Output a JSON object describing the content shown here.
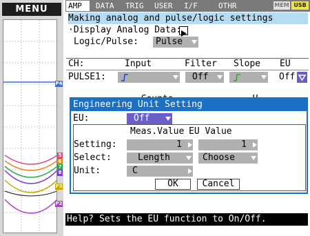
{
  "menu_label": "MENU",
  "tabs": [
    {
      "label": "AMP",
      "active": true
    },
    {
      "label": "DATA"
    },
    {
      "label": "TRIG"
    },
    {
      "label": "USER"
    },
    {
      "label": "I/F"
    },
    {
      "label": "OTHR"
    }
  ],
  "badges": [
    "MEM",
    "USB"
  ],
  "heading": "Making analog and pulse/logic settings",
  "display_analog_label": "·Display Analog Data:",
  "display_analog_icon": "play-triangle-icon",
  "logic_pulse": {
    "label": "Logic/Pulse:",
    "value": "Pulse"
  },
  "channel_table": {
    "headers": [
      "CH:",
      "Input",
      "Filter",
      "Slope",
      "EU"
    ],
    "row": {
      "ch": "PULSE1:",
      "input": "Counts",
      "filter": "Off",
      "slope": "H",
      "eu": "Off"
    }
  },
  "dialog": {
    "title": "Engineering Unit Setting",
    "eu_label": "EU:",
    "eu_value": "Off",
    "col_meas": "Meas.Value",
    "col_eu": "EU Value",
    "setting_label": "Setting:",
    "setting_meas": "1",
    "setting_eu": "1",
    "select_label": "Select:",
    "select_meas": "Length",
    "select_eu": "Choose",
    "unit_label": "Unit:",
    "unit_value": "C",
    "ok_label": "OK",
    "cancel_label": "Cancel"
  },
  "channel_markers": [
    {
      "label": "P4",
      "color": "#3a6fd8"
    },
    {
      "label": "5",
      "color": "#e04a8a"
    },
    {
      "label": "6",
      "color": "#e08a1a"
    },
    {
      "label": "7",
      "color": "#2aa84a"
    },
    {
      "label": "8",
      "color": "#7a3ad8"
    },
    {
      "label": "P3",
      "color": "#c8a800"
    },
    {
      "label": "P2",
      "color": "#b03ad0"
    }
  ],
  "help_text": "Help? Sets the EU function to On/Off.",
  "colors": {
    "dialog_title_bg": "#1b6fc4",
    "heading_highlight": "#b5dcf2",
    "field_bg": "#b0b0b0",
    "eu_selected_bg": "#6a5fc8",
    "slope_icon": "#22aa22",
    "input_icon": "#2244cc"
  }
}
